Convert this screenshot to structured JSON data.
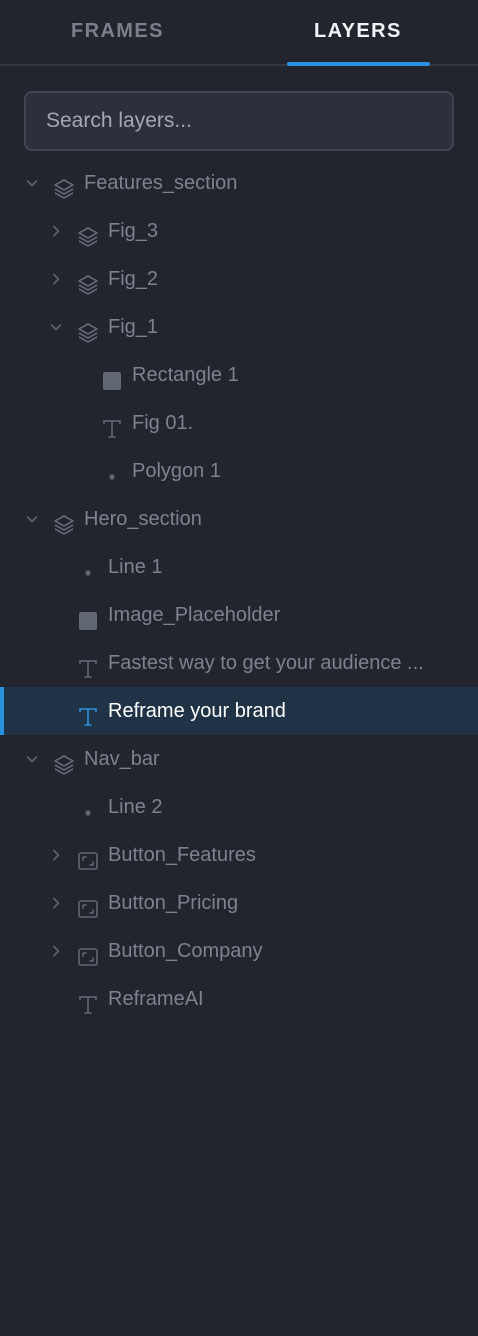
{
  "tabs": {
    "frames_label": "FRAMES",
    "layers_label": "LAYERS",
    "active": "LAYERS"
  },
  "search": {
    "placeholder": "Search layers..."
  },
  "colors": {
    "background": "#22252e",
    "accent": "#2a93de",
    "selected_row": "#1f3246",
    "text_muted": "#7d828e"
  },
  "layers": [
    {
      "name": "layer-features-section",
      "level": 0,
      "label": "Features_section",
      "icon": "layers-icon",
      "chevron": "down",
      "selected": false
    },
    {
      "name": "layer-fig-3",
      "level": 1,
      "label": "Fig_3",
      "icon": "layers-icon",
      "chevron": "right",
      "selected": false
    },
    {
      "name": "layer-fig-2",
      "level": 1,
      "label": "Fig_2",
      "icon": "layers-icon",
      "chevron": "right",
      "selected": false
    },
    {
      "name": "layer-fig-1",
      "level": 1,
      "label": "Fig_1",
      "icon": "layers-icon",
      "chevron": "down",
      "selected": false
    },
    {
      "name": "layer-rectangle-1",
      "level": 2,
      "label": "Rectangle 1",
      "icon": "rectangle-icon",
      "chevron": null,
      "selected": false
    },
    {
      "name": "layer-fig-01",
      "level": 2,
      "label": "Fig 01.",
      "icon": "text-icon",
      "chevron": null,
      "selected": false
    },
    {
      "name": "layer-polygon-1",
      "level": 2,
      "label": "Polygon 1",
      "icon": "dot-icon",
      "chevron": null,
      "selected": false
    },
    {
      "name": "layer-hero-section",
      "level": 0,
      "label": "Hero_section",
      "icon": "layers-icon",
      "chevron": "down",
      "selected": false
    },
    {
      "name": "layer-line-1",
      "level": 1,
      "label": "Line 1",
      "icon": "dot-icon",
      "chevron": null,
      "selected": false
    },
    {
      "name": "layer-image-placeholder",
      "level": 1,
      "label": "Image_Placeholder",
      "icon": "rectangle-icon",
      "chevron": null,
      "selected": false
    },
    {
      "name": "layer-fastest-way",
      "level": 1,
      "label": "Fastest way to get your audience ...",
      "icon": "text-icon",
      "chevron": null,
      "selected": false
    },
    {
      "name": "layer-reframe-your-brand",
      "level": 1,
      "label": "Reframe your brand",
      "icon": "text-icon",
      "chevron": null,
      "selected": true
    },
    {
      "name": "layer-nav-bar",
      "level": 0,
      "label": "Nav_bar",
      "icon": "layers-icon",
      "chevron": "down",
      "selected": false
    },
    {
      "name": "layer-line-2",
      "level": 1,
      "label": "Line 2",
      "icon": "dot-icon",
      "chevron": null,
      "selected": false
    },
    {
      "name": "layer-button-features",
      "level": 1,
      "label": "Button_Features",
      "icon": "frame-icon",
      "chevron": "right",
      "selected": false
    },
    {
      "name": "layer-button-pricing",
      "level": 1,
      "label": "Button_Pricing",
      "icon": "frame-icon",
      "chevron": "right",
      "selected": false
    },
    {
      "name": "layer-button-company",
      "level": 1,
      "label": "Button_Company",
      "icon": "frame-icon",
      "chevron": "right",
      "selected": false
    },
    {
      "name": "layer-reframeai",
      "level": 1,
      "label": "ReframeAI",
      "icon": "text-icon",
      "chevron": null,
      "selected": false
    }
  ]
}
